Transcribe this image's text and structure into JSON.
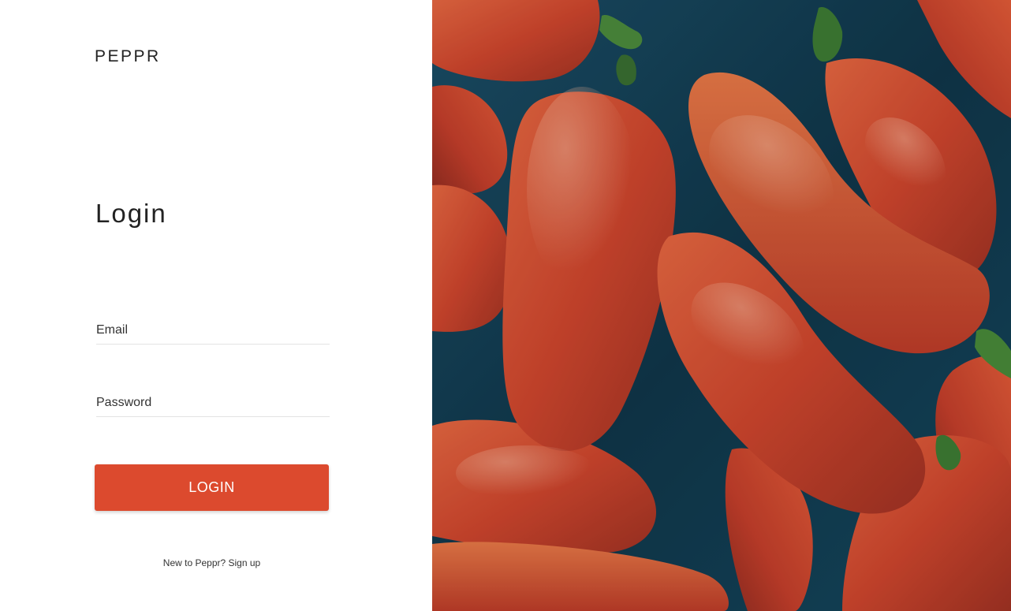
{
  "brand": {
    "name": "PEPPR"
  },
  "login": {
    "title": "Login",
    "email_placeholder": "Email",
    "password_placeholder": "Password",
    "submit_label": "LOGIN",
    "signup_prompt": "New to Peppr?",
    "signup_link": "Sign up"
  },
  "hero": {
    "image_subject": "red-peppers-in-water"
  },
  "colors": {
    "accent": "#dc4a2e",
    "water": "#123f56",
    "text": "#222222"
  }
}
